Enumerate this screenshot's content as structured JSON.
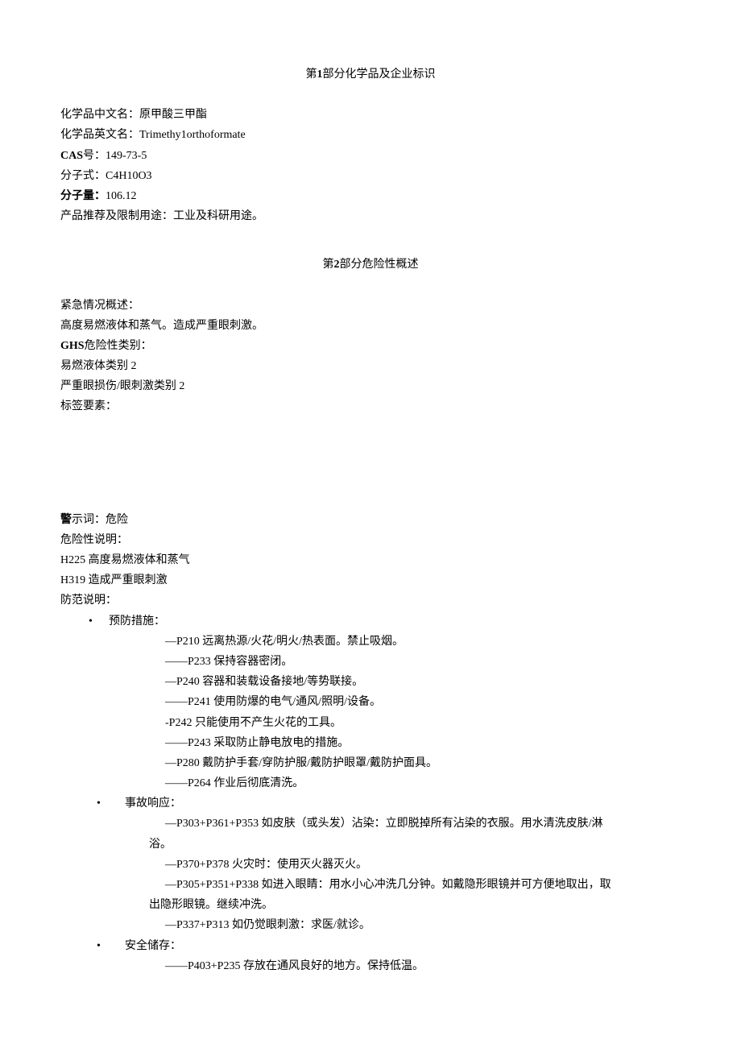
{
  "section1": {
    "title_prefix": "第",
    "title_num": "1",
    "title_suffix": "部分化学品及企业标识",
    "name_cn_label": "化学品中文名：",
    "name_cn_value": "原甲酸三甲酯",
    "name_en_label": "化学品英文名：",
    "name_en_value": "Trimethy1orthoformate",
    "cas_label": "CAS",
    "cas_suffix": "号：",
    "cas_value": "149-73-5",
    "formula_label": "分子式：",
    "formula_value": "C4H10O3",
    "mw_label": "分子量：",
    "mw_value": "106.12",
    "use_label": "产品推荐及限制用途：",
    "use_value": "工业及科研用途。"
  },
  "section2": {
    "title_prefix": "第",
    "title_num": "2",
    "title_suffix": "部分危险性概述",
    "emergency_label": "紧急情况概述：",
    "emergency_text": "高度易燃液体和蒸气。造成严重眼刺激。",
    "ghs_label": "GHS",
    "ghs_suffix": "危险性类别：",
    "ghs_class1": "易燃液体类别 2",
    "ghs_class2": "严重眼损伤/眼刺激类别 2",
    "label_elements": "标签要素：",
    "signal_word_label": "警",
    "signal_word_suffix": "示词：危险",
    "hazard_label": "危险性说明：",
    "h225": "H225 高度易燃液体和蒸气",
    "h319": "H319 造成严重眼刺激",
    "precaution_label": "防范说明：",
    "prevention_label": "预防措施：",
    "p210": "—P210 远离热源/火花/明火/热表面。禁止吸烟。",
    "p233": "——P233 保持容器密闭。",
    "p240": "—P240 容器和装载设备接地/等势联接。",
    "p241": "——P241 使用防爆的电气/通风/照明/设备。",
    "p242": "-P242 只能使用不产生火花的工具。",
    "p243": "——P243 采取防止静电放电的措施。",
    "p280": "—P280 戴防护手套/穿防护服/戴防护眼罩/戴防护面具。",
    "p264": "——P264 作业后彻底清洗。",
    "response_label": "事故响应：",
    "p303": "—P303+P361+P353 如皮肤（或头发）沾染：立即脱掉所有沾染的衣服。用水清洗皮肤/淋",
    "p303_cont": "浴。",
    "p370": "—P370+P378 火灾时：使用灭火器灭火。",
    "p305": "—P305+P351+P338 如进入眼睛：用水小心冲洗几分钟。如戴隐形眼镜并可方便地取出，取",
    "p305_cont": "出隐形眼镜。继续冲洗。",
    "p337": "—P337+P313 如仍觉眼刺激：求医/就诊。",
    "storage_label": "安全储存：",
    "p403": "——P403+P235 存放在通风良好的地方。保持低温。"
  }
}
